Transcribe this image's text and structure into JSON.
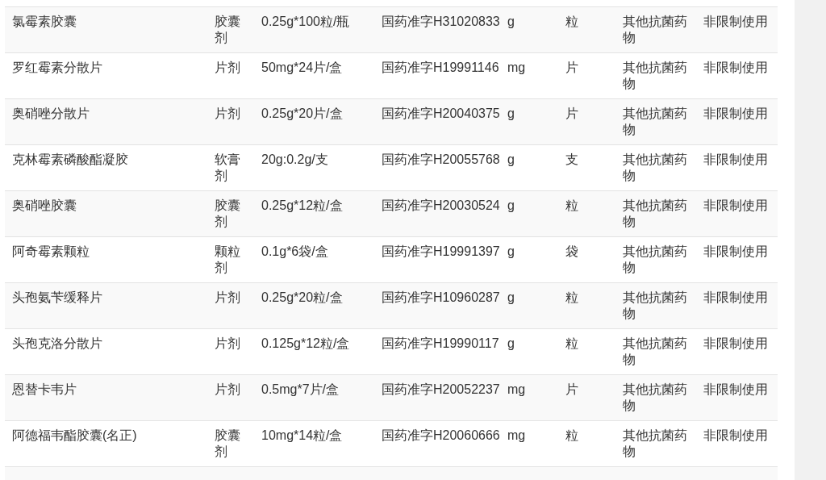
{
  "table": {
    "rows": [
      {
        "cells": [
          "氯霉素胶囊",
          "胶囊剂",
          "0.25g*100粒/瓶",
          "国药准字H31020833",
          "g",
          "粒",
          "其他抗菌药物",
          "非限制使用"
        ]
      },
      {
        "cells": [
          "罗红霉素分散片",
          "片剂",
          "50mg*24片/盒",
          "国药准字H19991146",
          "mg",
          "片",
          "其他抗菌药物",
          "非限制使用"
        ]
      },
      {
        "cells": [
          "奥硝唑分散片",
          "片剂",
          "0.25g*20片/盒",
          "国药准字H20040375",
          "g",
          "片",
          "其他抗菌药物",
          "非限制使用"
        ]
      },
      {
        "cells": [
          "克林霉素磷酸酯凝胶",
          "软膏剂",
          "20g:0.2g/支",
          "国药准字H20055768",
          "g",
          "支",
          "其他抗菌药物",
          "非限制使用"
        ]
      },
      {
        "cells": [
          "奥硝唑胶囊",
          "胶囊剂",
          "0.25g*12粒/盒",
          "国药准字H20030524",
          "g",
          "粒",
          "其他抗菌药物",
          "非限制使用"
        ]
      },
      {
        "cells": [
          "阿奇霉素颗粒",
          "颗粒剂",
          "0.1g*6袋/盒",
          "国药准字H19991397",
          "g",
          "袋",
          "其他抗菌药物",
          "非限制使用"
        ]
      },
      {
        "cells": [
          "头孢氨苄缓释片",
          "片剂",
          "0.25g*20粒/盒",
          "国药准字H10960287",
          "g",
          "粒",
          "其他抗菌药物",
          "非限制使用"
        ]
      },
      {
        "cells": [
          "头孢克洛分散片",
          "片剂",
          "0.125g*12粒/盒",
          "国药准字H19990117",
          "g",
          "粒",
          "其他抗菌药物",
          "非限制使用"
        ]
      },
      {
        "cells": [
          "恩替卡韦片",
          "片剂",
          "0.5mg*7片/盒",
          "国药准字H20052237",
          "mg",
          "片",
          "其他抗菌药物",
          "非限制使用"
        ]
      },
      {
        "cells": [
          "阿德福韦酯胶囊(名正)",
          "胶囊剂",
          "10mg*14粒/盒",
          "国药准字H20060666",
          "mg",
          "粒",
          "其他抗菌药物",
          "非限制使用"
        ]
      }
    ]
  }
}
